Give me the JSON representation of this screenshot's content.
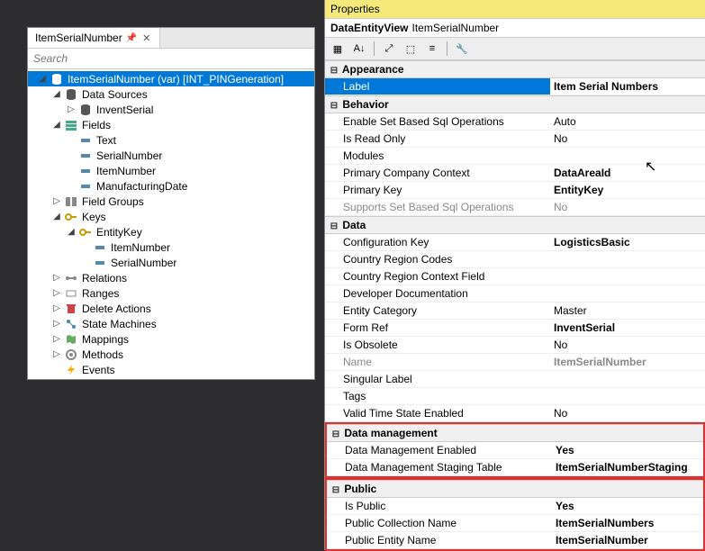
{
  "leftPanel": {
    "tabTitle": "ItemSerialNumber",
    "searchPlaceholder": "Search",
    "tree": [
      {
        "depth": 0,
        "toggle": "▲",
        "icon": "db",
        "label": "ItemSerialNumber (var) [INT_PINGeneration]",
        "selected": true
      },
      {
        "depth": 1,
        "toggle": "▲",
        "icon": "ds",
        "label": "Data Sources"
      },
      {
        "depth": 2,
        "toggle": "▷",
        "icon": "ds",
        "label": "InventSerial"
      },
      {
        "depth": 1,
        "toggle": "▲",
        "icon": "fld",
        "label": "Fields"
      },
      {
        "depth": 2,
        "toggle": "",
        "icon": "f",
        "label": "Text"
      },
      {
        "depth": 2,
        "toggle": "",
        "icon": "f",
        "label": "SerialNumber"
      },
      {
        "depth": 2,
        "toggle": "",
        "icon": "f",
        "label": "ItemNumber"
      },
      {
        "depth": 2,
        "toggle": "",
        "icon": "f",
        "label": "ManufacturingDate"
      },
      {
        "depth": 1,
        "toggle": "▷",
        "icon": "fg",
        "label": "Field Groups"
      },
      {
        "depth": 1,
        "toggle": "▲",
        "icon": "key",
        "label": "Keys"
      },
      {
        "depth": 2,
        "toggle": "▲",
        "icon": "key",
        "label": "EntityKey"
      },
      {
        "depth": 3,
        "toggle": "",
        "icon": "f",
        "label": "ItemNumber"
      },
      {
        "depth": 3,
        "toggle": "",
        "icon": "f",
        "label": "SerialNumber"
      },
      {
        "depth": 1,
        "toggle": "▷",
        "icon": "rel",
        "label": "Relations"
      },
      {
        "depth": 1,
        "toggle": "▷",
        "icon": "rng",
        "label": "Ranges"
      },
      {
        "depth": 1,
        "toggle": "▷",
        "icon": "del",
        "label": "Delete Actions"
      },
      {
        "depth": 1,
        "toggle": "▷",
        "icon": "sm",
        "label": "State Machines"
      },
      {
        "depth": 1,
        "toggle": "▷",
        "icon": "map",
        "label": "Mappings"
      },
      {
        "depth": 1,
        "toggle": "▷",
        "icon": "mth",
        "label": "Methods"
      },
      {
        "depth": 1,
        "toggle": "",
        "icon": "evt",
        "label": "Events"
      }
    ]
  },
  "propertiesPanel": {
    "title": "Properties",
    "subheaderType": "DataEntityView",
    "subheaderName": "ItemSerialNumber",
    "categories": [
      {
        "name": "Appearance",
        "highlight": false,
        "rows": [
          {
            "label": "Label",
            "value": "Item Serial Numbers",
            "bold": true,
            "selected": true
          }
        ]
      },
      {
        "name": "Behavior",
        "highlight": false,
        "rows": [
          {
            "label": "Enable Set Based Sql Operations",
            "value": "Auto"
          },
          {
            "label": "Is Read Only",
            "value": "No"
          },
          {
            "label": "Modules",
            "value": ""
          },
          {
            "label": "Primary Company Context",
            "value": "DataAreaId",
            "bold": true
          },
          {
            "label": "Primary Key",
            "value": "EntityKey",
            "bold": true
          },
          {
            "label": "Supports Set Based Sql Operations",
            "value": "No",
            "dim": true
          }
        ]
      },
      {
        "name": "Data",
        "highlight": false,
        "rows": [
          {
            "label": "Configuration Key",
            "value": "LogisticsBasic",
            "bold": true
          },
          {
            "label": "Country Region Codes",
            "value": ""
          },
          {
            "label": "Country Region Context Field",
            "value": ""
          },
          {
            "label": "Developer Documentation",
            "value": ""
          },
          {
            "label": "Entity Category",
            "value": "Master"
          },
          {
            "label": "Form Ref",
            "value": "InventSerial",
            "bold": true
          },
          {
            "label": "Is Obsolete",
            "value": "No"
          },
          {
            "label": "Name",
            "value": "ItemSerialNumber",
            "bold": true,
            "dim": true
          },
          {
            "label": "Singular Label",
            "value": ""
          },
          {
            "label": "Tags",
            "value": ""
          },
          {
            "label": "Valid Time State Enabled",
            "value": "No"
          }
        ]
      },
      {
        "name": "Data management",
        "highlight": true,
        "rows": [
          {
            "label": "Data Management Enabled",
            "value": "Yes",
            "bold": true
          },
          {
            "label": "Data Management Staging Table",
            "value": "ItemSerialNumberStaging",
            "bold": true
          }
        ]
      },
      {
        "name": "Public",
        "highlight": true,
        "rows": [
          {
            "label": "Is Public",
            "value": "Yes",
            "bold": true
          },
          {
            "label": "Public Collection Name",
            "value": "ItemSerialNumbers",
            "bold": true
          },
          {
            "label": "Public Entity Name",
            "value": "ItemSerialNumber",
            "bold": true
          }
        ]
      }
    ]
  }
}
